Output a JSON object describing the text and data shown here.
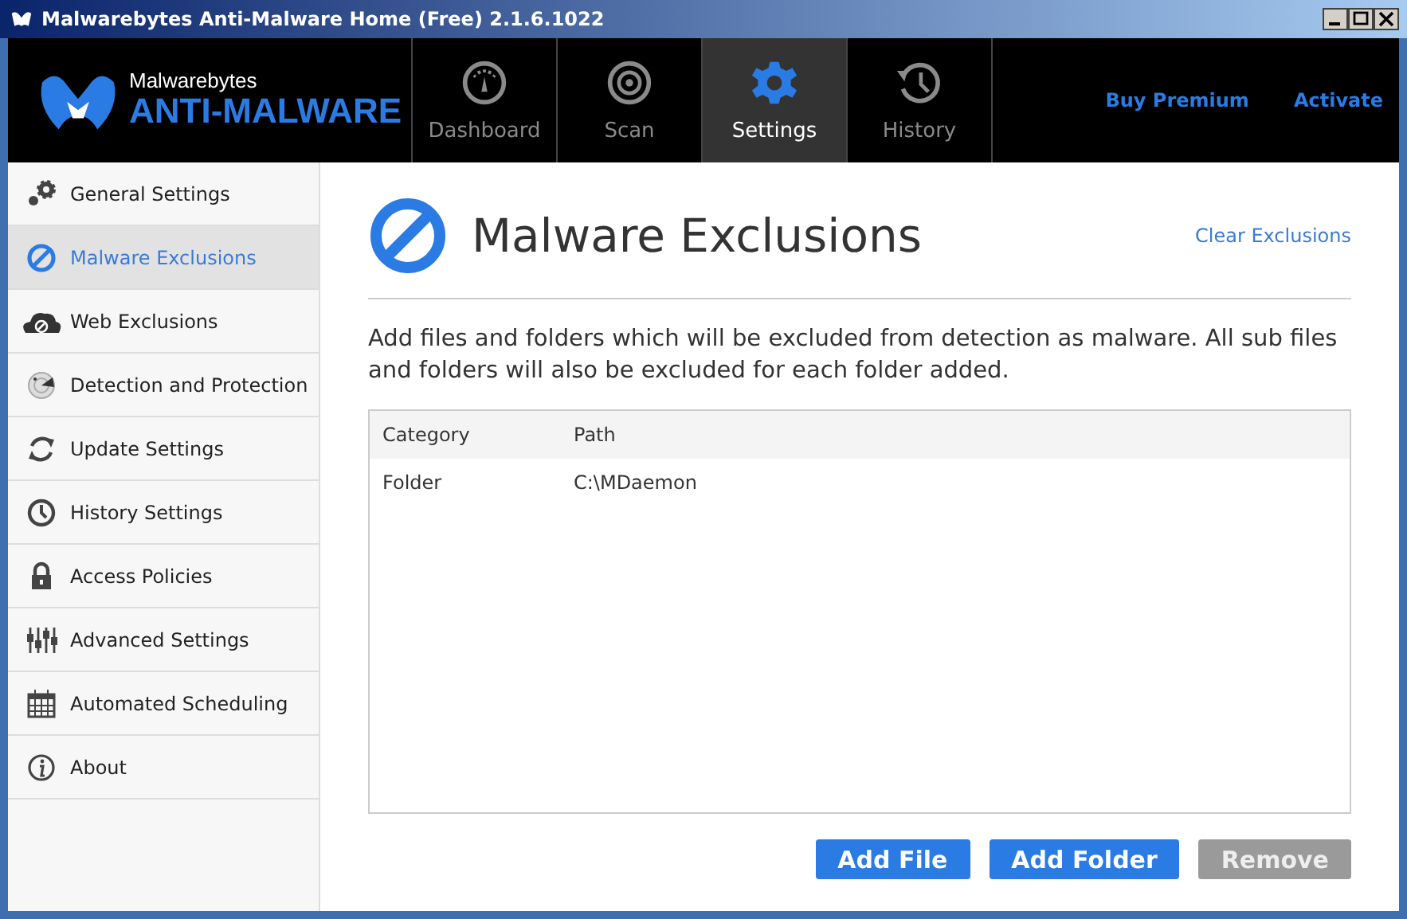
{
  "window": {
    "title": "Malwarebytes Anti-Malware Home (Free) 2.1.6.1022"
  },
  "logo": {
    "brand": "Malwarebytes",
    "product": "ANTI-MALWARE"
  },
  "tabs": [
    {
      "label": "Dashboard",
      "selected": false
    },
    {
      "label": "Scan",
      "selected": false
    },
    {
      "label": "Settings",
      "selected": true
    },
    {
      "label": "History",
      "selected": false
    }
  ],
  "header_links": [
    "Buy Premium",
    "Activate"
  ],
  "sidebar": {
    "items": [
      {
        "label": "General Settings",
        "selected": false
      },
      {
        "label": "Malware Exclusions",
        "selected": true
      },
      {
        "label": "Web Exclusions",
        "selected": false
      },
      {
        "label": "Detection and Protection",
        "selected": false
      },
      {
        "label": "Update Settings",
        "selected": false
      },
      {
        "label": "History Settings",
        "selected": false
      },
      {
        "label": "Access Policies",
        "selected": false
      },
      {
        "label": "Advanced Settings",
        "selected": false
      },
      {
        "label": "Automated Scheduling",
        "selected": false
      },
      {
        "label": "About",
        "selected": false
      }
    ]
  },
  "page": {
    "title": "Malware Exclusions",
    "clear_link": "Clear Exclusions",
    "description": "Add files and folders which will be excluded from detection as malware. All sub files and folders will also be excluded for each folder added."
  },
  "table": {
    "columns": [
      "Category",
      "Path"
    ],
    "rows": [
      [
        "Folder",
        "C:\\MDaemon"
      ]
    ]
  },
  "buttons": [
    {
      "label": "Add File",
      "disabled": false
    },
    {
      "label": "Add Folder",
      "disabled": false
    },
    {
      "label": "Remove",
      "disabled": true
    }
  ]
}
